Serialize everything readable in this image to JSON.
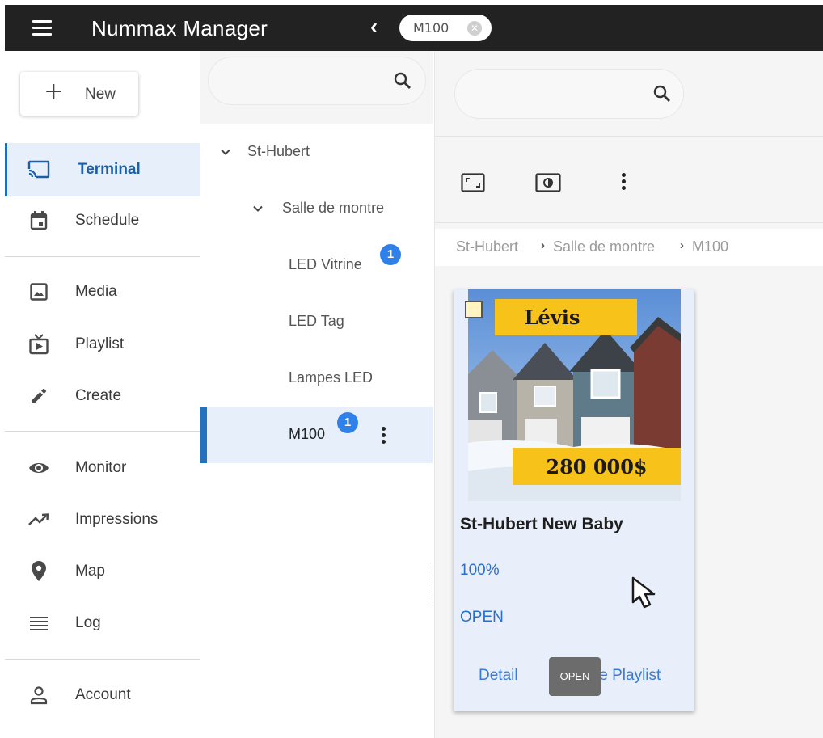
{
  "app": {
    "title": "Nummax Manager"
  },
  "topbar": {
    "chip_label": "M100"
  },
  "nav": {
    "new_label": "New",
    "items": [
      {
        "label": "Terminal",
        "icon": "cast-icon",
        "active": true
      },
      {
        "label": "Schedule",
        "icon": "calendar-icon"
      },
      {
        "label": "Media",
        "icon": "image-icon"
      },
      {
        "label": "Playlist",
        "icon": "playlist-icon"
      },
      {
        "label": "Create",
        "icon": "pencil-icon"
      },
      {
        "label": "Monitor",
        "icon": "eye-icon"
      },
      {
        "label": "Impressions",
        "icon": "trending-icon"
      },
      {
        "label": "Map",
        "icon": "pin-icon"
      },
      {
        "label": "Log",
        "icon": "list-icon"
      },
      {
        "label": "Account",
        "icon": "person-icon"
      }
    ]
  },
  "tree": {
    "root": "St-Hubert",
    "group": "Salle de montre",
    "items": [
      {
        "label": "LED Vitrine",
        "badge": "1"
      },
      {
        "label": "LED Tag"
      },
      {
        "label": "Lampes LED"
      },
      {
        "label": "M100",
        "badge": "1",
        "active": true
      }
    ]
  },
  "main": {
    "breadcrumb": [
      "St-Hubert",
      "Salle de montre",
      "M100"
    ],
    "card": {
      "title": "St-Hubert New Baby",
      "percent": "100%",
      "status": "OPEN",
      "image_banner": "Lévis",
      "image_price": "280 000$",
      "actions": {
        "detail": "Detail",
        "playlist_partial": "te Playlist"
      },
      "tooltip": "OPEN"
    }
  },
  "colors": {
    "accent": "#1e6fb8",
    "active_bg": "#e7effb",
    "badge": "#2f80e8",
    "topbar": "#222222",
    "banner": "#f7c21a"
  }
}
